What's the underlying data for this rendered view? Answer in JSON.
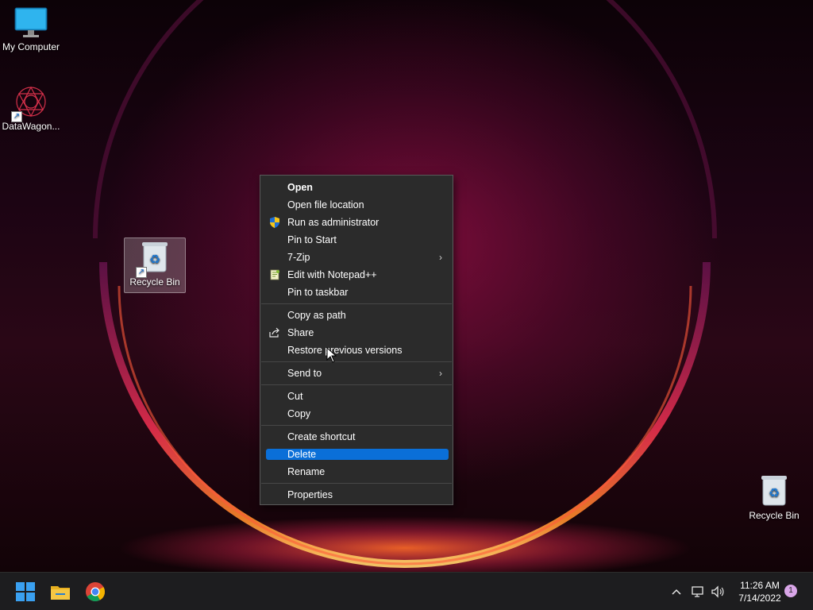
{
  "desktop": {
    "icons": {
      "my_computer": "My Computer",
      "datawagon": "DataWagon...",
      "recycle_selected": "Recycle Bin",
      "recycle_right": "Recycle Bin"
    }
  },
  "context_menu": {
    "open": "Open",
    "open_file_location": "Open file location",
    "run_as_admin": "Run as administrator",
    "pin_to_start": "Pin to Start",
    "seven_zip": "7-Zip",
    "edit_notepad": "Edit with Notepad++",
    "pin_to_taskbar": "Pin to taskbar",
    "copy_as_path": "Copy as path",
    "share": "Share",
    "restore_previous": "Restore previous versions",
    "send_to": "Send to",
    "cut": "Cut",
    "copy": "Copy",
    "create_shortcut": "Create shortcut",
    "delete": "Delete",
    "rename": "Rename",
    "properties": "Properties",
    "highlight_color": "#0a6fd8"
  },
  "taskbar": {
    "time": "11:26 AM",
    "date": "7/14/2022",
    "notification_count": "1"
  }
}
